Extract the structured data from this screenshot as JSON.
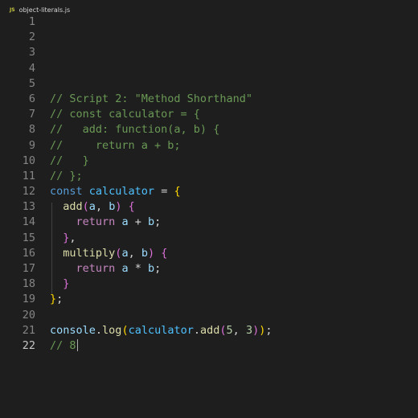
{
  "tab": {
    "icon": "JS",
    "filename": "object-literals.js"
  },
  "editor": {
    "active_line": 22,
    "lines": [
      {
        "n": "1",
        "tokens": []
      },
      {
        "n": "2",
        "tokens": []
      },
      {
        "n": "3",
        "tokens": []
      },
      {
        "n": "4",
        "tokens": []
      },
      {
        "n": "5",
        "tokens": []
      },
      {
        "n": "6",
        "tokens": [
          {
            "t": "// Script 2: \"Method Shorthand\"",
            "c": "cm"
          }
        ]
      },
      {
        "n": "7",
        "tokens": [
          {
            "t": "// const calculator = {",
            "c": "cm"
          }
        ]
      },
      {
        "n": "8",
        "tokens": [
          {
            "t": "//   add: function(a, b) {",
            "c": "cm"
          }
        ]
      },
      {
        "n": "9",
        "tokens": [
          {
            "t": "//     return a + b;",
            "c": "cm"
          }
        ]
      },
      {
        "n": "10",
        "tokens": [
          {
            "t": "//   }",
            "c": "cm"
          }
        ]
      },
      {
        "n": "11",
        "tokens": [
          {
            "t": "// };",
            "c": "cm"
          }
        ]
      },
      {
        "n": "12",
        "tokens": [
          {
            "t": "const ",
            "c": "kw"
          },
          {
            "t": "calculator",
            "c": "cn"
          },
          {
            "t": " = ",
            "c": "op"
          },
          {
            "t": "{",
            "c": "b1"
          }
        ]
      },
      {
        "n": "13",
        "tokens": [
          {
            "t": "  ",
            "c": "op"
          },
          {
            "t": "add",
            "c": "fn"
          },
          {
            "t": "(",
            "c": "b2"
          },
          {
            "t": "a",
            "c": "vr"
          },
          {
            "t": ", ",
            "c": "op"
          },
          {
            "t": "b",
            "c": "vr"
          },
          {
            "t": ")",
            "c": "b2"
          },
          {
            "t": " ",
            "c": "op"
          },
          {
            "t": "{",
            "c": "b2"
          }
        ]
      },
      {
        "n": "14",
        "tokens": [
          {
            "t": "    ",
            "c": "op"
          },
          {
            "t": "return",
            "c": "ct"
          },
          {
            "t": " ",
            "c": "op"
          },
          {
            "t": "a",
            "c": "vr"
          },
          {
            "t": " + ",
            "c": "op"
          },
          {
            "t": "b",
            "c": "vr"
          },
          {
            "t": ";",
            "c": "op"
          }
        ]
      },
      {
        "n": "15",
        "tokens": [
          {
            "t": "  ",
            "c": "op"
          },
          {
            "t": "}",
            "c": "b2"
          },
          {
            "t": ",",
            "c": "op"
          }
        ]
      },
      {
        "n": "16",
        "tokens": [
          {
            "t": "  ",
            "c": "op"
          },
          {
            "t": "multiply",
            "c": "fn"
          },
          {
            "t": "(",
            "c": "b2"
          },
          {
            "t": "a",
            "c": "vr"
          },
          {
            "t": ", ",
            "c": "op"
          },
          {
            "t": "b",
            "c": "vr"
          },
          {
            "t": ")",
            "c": "b2"
          },
          {
            "t": " ",
            "c": "op"
          },
          {
            "t": "{",
            "c": "b2"
          }
        ]
      },
      {
        "n": "17",
        "tokens": [
          {
            "t": "    ",
            "c": "op"
          },
          {
            "t": "return",
            "c": "ct"
          },
          {
            "t": " ",
            "c": "op"
          },
          {
            "t": "a",
            "c": "vr"
          },
          {
            "t": " * ",
            "c": "op"
          },
          {
            "t": "b",
            "c": "vr"
          },
          {
            "t": ";",
            "c": "op"
          }
        ]
      },
      {
        "n": "18",
        "tokens": [
          {
            "t": "  ",
            "c": "op"
          },
          {
            "t": "}",
            "c": "b2"
          }
        ]
      },
      {
        "n": "19",
        "tokens": [
          {
            "t": "}",
            "c": "b1"
          },
          {
            "t": ";",
            "c": "op"
          }
        ]
      },
      {
        "n": "20",
        "tokens": []
      },
      {
        "n": "21",
        "tokens": [
          {
            "t": "console",
            "c": "vr"
          },
          {
            "t": ".",
            "c": "op"
          },
          {
            "t": "log",
            "c": "fn"
          },
          {
            "t": "(",
            "c": "b1"
          },
          {
            "t": "calculator",
            "c": "cn"
          },
          {
            "t": ".",
            "c": "op"
          },
          {
            "t": "add",
            "c": "fn"
          },
          {
            "t": "(",
            "c": "b2"
          },
          {
            "t": "5",
            "c": "nm"
          },
          {
            "t": ", ",
            "c": "op"
          },
          {
            "t": "3",
            "c": "nm"
          },
          {
            "t": ")",
            "c": "b2"
          },
          {
            "t": ")",
            "c": "b1"
          },
          {
            "t": ";",
            "c": "op"
          }
        ]
      },
      {
        "n": "22",
        "tokens": [
          {
            "t": "// 8",
            "c": "cm"
          }
        ]
      }
    ]
  },
  "colors": {
    "background": "#1e1e1e",
    "comment": "#6a9955",
    "keyword": "#569cd6",
    "constant": "#4fc1ff",
    "function": "#dcdcaa",
    "control": "#c586c0",
    "number": "#b5cea8",
    "bracket_1": "#ffd700",
    "bracket_2": "#da70d6"
  }
}
